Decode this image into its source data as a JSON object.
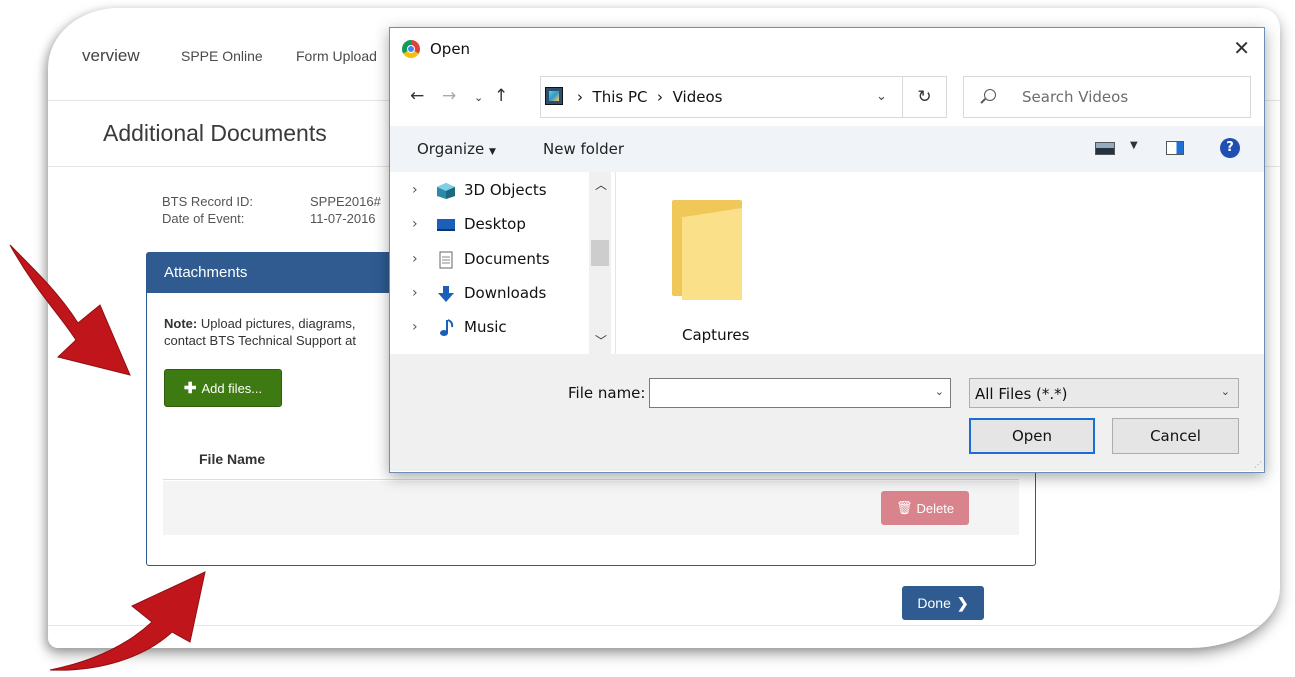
{
  "nav": {
    "overview": "verview",
    "sppe_online": "SPPE Online",
    "form_upload": "Form Upload"
  },
  "page": {
    "title": "Additional Documents",
    "record_id_label": "BTS Record ID:",
    "record_id_value": "SPPE2016#",
    "date_label": "Date of Event:",
    "date_value": "11-07-2016"
  },
  "attachments": {
    "header": "Attachments",
    "note_bold": "Note:",
    "note_line1": " Upload pictures, diagrams,",
    "note_line2": "contact BTS Technical Support at",
    "add_files_label": "Add files...",
    "file_name_header": "File Name",
    "delete_label": "Delete"
  },
  "done_label": "Done",
  "dialog": {
    "title": "Open",
    "path_this_pc": "This PC",
    "path_videos": "Videos",
    "search_placeholder": "Search Videos",
    "organize_label": "Organize",
    "new_folder_label": "New folder",
    "tree": [
      {
        "label": "3D Objects",
        "icon": "3d-objects-icon"
      },
      {
        "label": "Desktop",
        "icon": "desktop-icon"
      },
      {
        "label": "Documents",
        "icon": "documents-icon"
      },
      {
        "label": "Downloads",
        "icon": "downloads-icon"
      },
      {
        "label": "Music",
        "icon": "music-icon"
      }
    ],
    "folder_label": "Captures",
    "file_name_label": "File name:",
    "file_name_value": "",
    "file_type_value": "All Files (*.*)",
    "open_label": "Open",
    "cancel_label": "Cancel"
  },
  "colors": {
    "header_blue": "#2f5b91",
    "add_green": "#3e7a12",
    "delete_pink": "#d9838c",
    "arrow_red": "#c0161b",
    "dialog_accent": "#1a6fd4"
  }
}
